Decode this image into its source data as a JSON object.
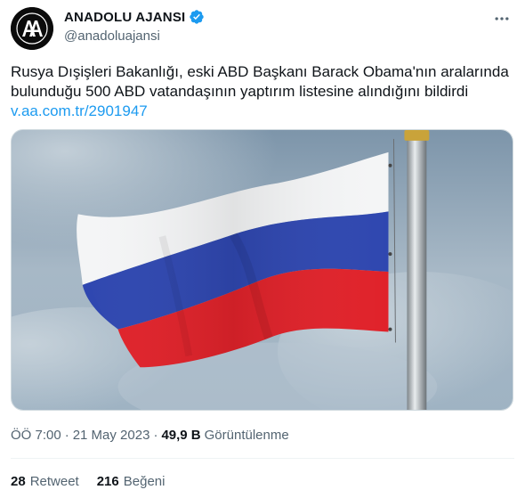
{
  "author": {
    "display_name": "ANADOLU AJANSI",
    "handle": "@anadoluajansi",
    "avatar_logo_text": "AA",
    "verified_icon": "verified-badge-icon",
    "brand_color": "#1d9bf0"
  },
  "tweet": {
    "text": "Rusya Dışişleri Bakanlığı, eski ABD Başkanı Barack Obama'nın aralarında bulunduğu 500 ABD vatandaşının yaptırım listesine alındığını bildirdi",
    "link": "v.aa.com.tr/2901947",
    "media_description_icon": "russian-flag-photo"
  },
  "meta": {
    "time": "ÖÖ 7:00",
    "separator": "·",
    "date": "21 May 2023",
    "views_count": "49,9 B",
    "views_label": "Görüntülenme"
  },
  "stats": {
    "retweets_count": "28",
    "retweets_label": "Retweet",
    "likes_count": "216",
    "likes_label": "Beğeni"
  },
  "colors": {
    "text_primary": "#0f1419",
    "text_secondary": "#536471",
    "link": "#1d9bf0",
    "divider": "#eff3f4"
  }
}
